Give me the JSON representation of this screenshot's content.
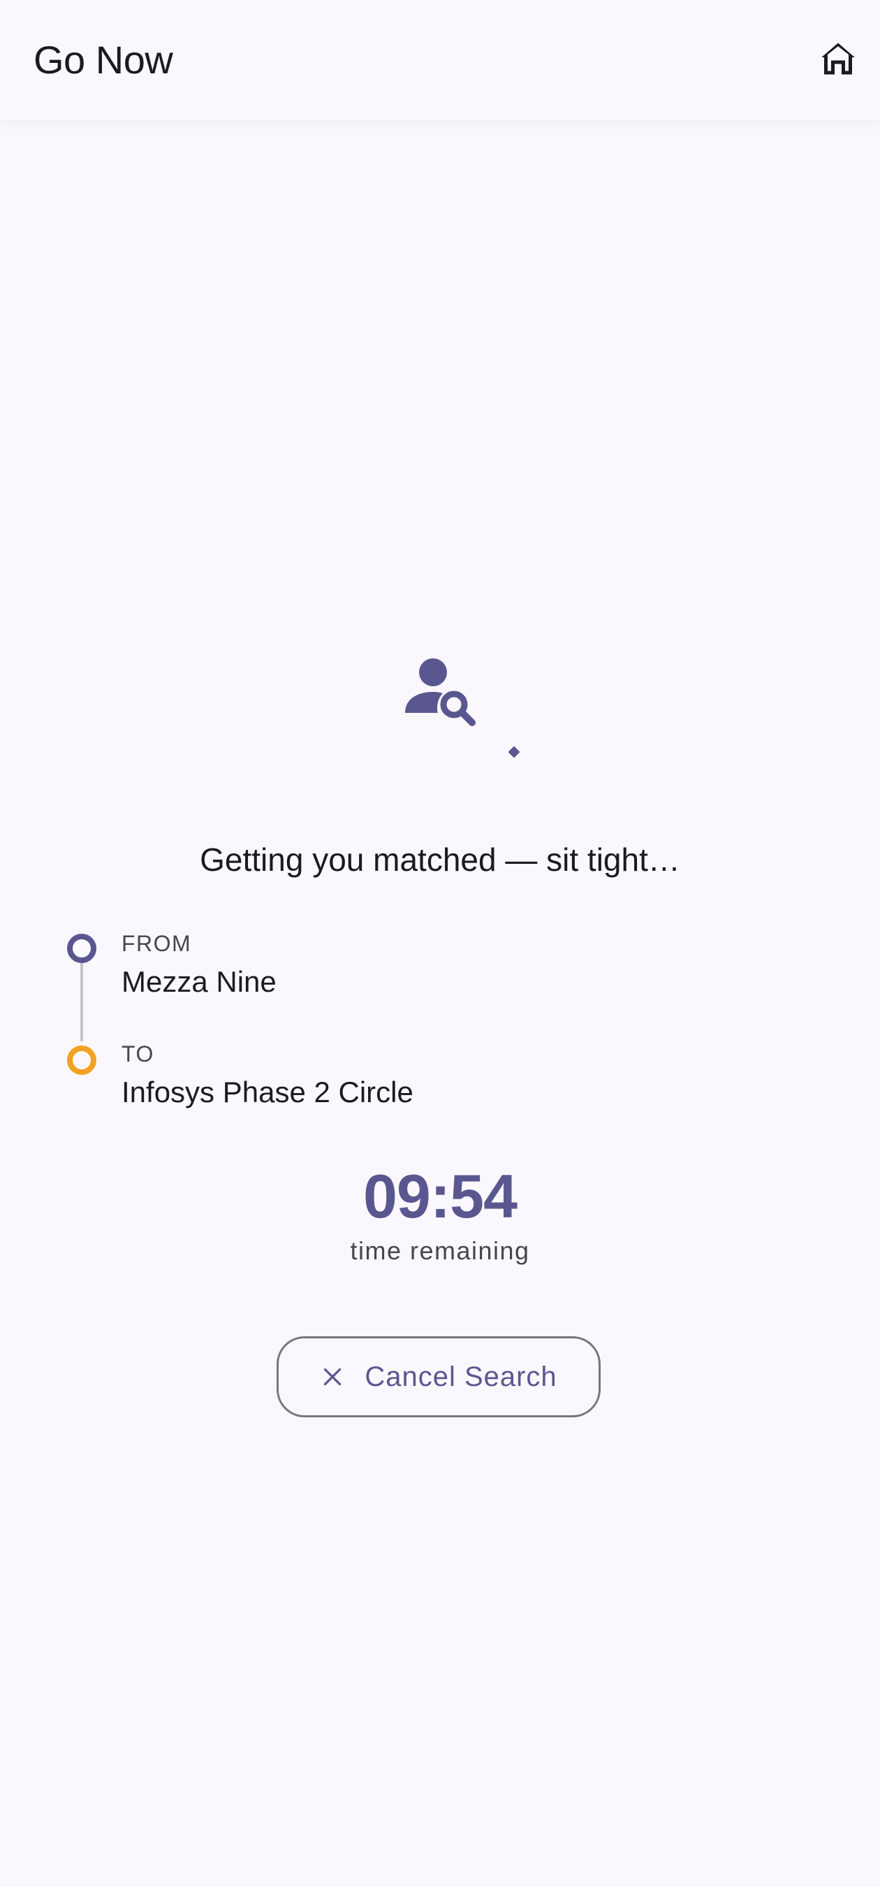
{
  "app_bar": {
    "title": "Go Now",
    "home_icon": "home-icon"
  },
  "status": {
    "icon": "person-search-icon",
    "heading": "Getting you matched — sit tight…"
  },
  "route": {
    "from_label": "FROM",
    "from_value": "Mezza Nine",
    "to_label": "TO",
    "to_value": "Infosys Phase 2 Circle"
  },
  "timer": {
    "value": "09:54",
    "caption": "time remaining"
  },
  "cancel_button": {
    "icon": "close-icon",
    "label": "Cancel Search"
  },
  "colors": {
    "primary": "#5a5790",
    "destination": "#f2a122",
    "background": "#faf8fe",
    "outline": "#77757f"
  }
}
